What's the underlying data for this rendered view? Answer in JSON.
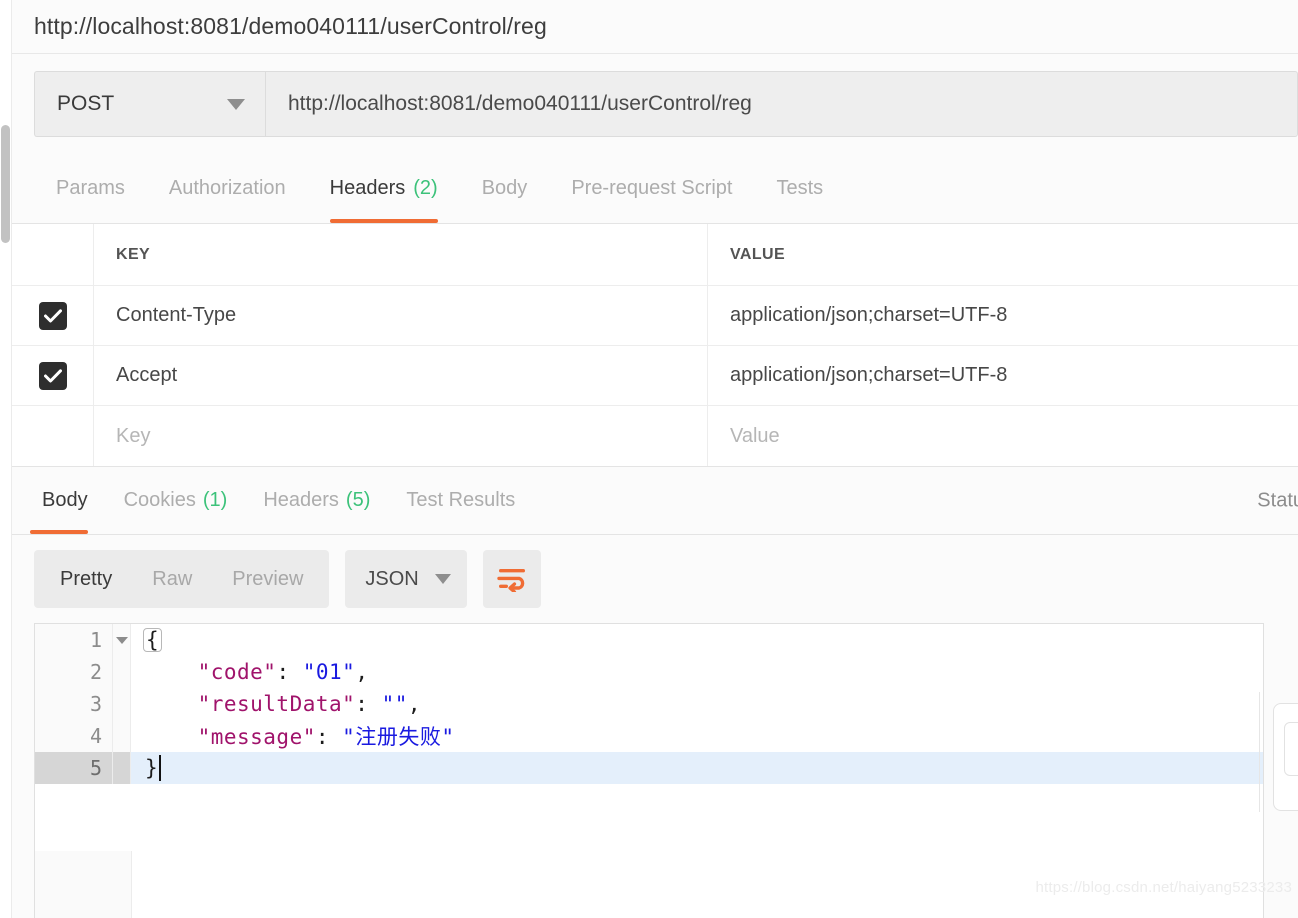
{
  "request": {
    "title": "http://localhost:8081/demo040111/userControl/reg",
    "method": "POST",
    "url": "http://localhost:8081/demo040111/userControl/reg",
    "tabs": [
      {
        "label": "Params",
        "badge": "",
        "active": false
      },
      {
        "label": "Authorization",
        "badge": "",
        "active": false
      },
      {
        "label": "Headers",
        "badge": "(2)",
        "active": true
      },
      {
        "label": "Body",
        "badge": "",
        "active": false
      },
      {
        "label": "Pre-request Script",
        "badge": "",
        "active": false
      },
      {
        "label": "Tests",
        "badge": "",
        "active": false
      }
    ]
  },
  "headers_table": {
    "columns": [
      "KEY",
      "VALUE"
    ],
    "rows": [
      {
        "checked": true,
        "key": "Content-Type",
        "value": "application/json;charset=UTF-8",
        "placeholder": false
      },
      {
        "checked": true,
        "key": "Accept",
        "value": "application/json;charset=UTF-8",
        "placeholder": false
      },
      {
        "checked": false,
        "key": "Key",
        "value": "Value",
        "placeholder": true
      }
    ]
  },
  "response": {
    "tabs": [
      {
        "label": "Body",
        "badge": "",
        "active": true
      },
      {
        "label": "Cookies",
        "badge": "(1)",
        "active": false
      },
      {
        "label": "Headers",
        "badge": "(5)",
        "active": false
      },
      {
        "label": "Test Results",
        "badge": "",
        "active": false
      }
    ],
    "status_label": "Statu",
    "view_modes": [
      {
        "label": "Pretty",
        "active": true
      },
      {
        "label": "Raw",
        "active": false
      },
      {
        "label": "Preview",
        "active": false
      }
    ],
    "language": "JSON",
    "wrap_icon": "word-wrap-icon",
    "body_lines": [
      {
        "number": "1",
        "foldable": true,
        "active": false,
        "tokens": [
          {
            "text": "{",
            "type": "brace-open"
          }
        ]
      },
      {
        "number": "2",
        "foldable": false,
        "active": false,
        "tokens": [
          {
            "text": "    \"code\"",
            "type": "key"
          },
          {
            "text": ": ",
            "type": "punct"
          },
          {
            "text": "\"01\"",
            "type": "str"
          },
          {
            "text": ",",
            "type": "punct"
          }
        ]
      },
      {
        "number": "3",
        "foldable": false,
        "active": false,
        "tokens": [
          {
            "text": "    \"resultData\"",
            "type": "key"
          },
          {
            "text": ": ",
            "type": "punct"
          },
          {
            "text": "\"\"",
            "type": "str"
          },
          {
            "text": ",",
            "type": "punct"
          }
        ]
      },
      {
        "number": "4",
        "foldable": false,
        "active": false,
        "tokens": [
          {
            "text": "    \"message\"",
            "type": "key"
          },
          {
            "text": ": ",
            "type": "punct"
          },
          {
            "text": "\"注册失败\"",
            "type": "str"
          }
        ]
      },
      {
        "number": "5",
        "foldable": false,
        "active": true,
        "tokens": [
          {
            "text": "}",
            "type": "punct"
          },
          {
            "text": "",
            "type": "caret"
          }
        ]
      }
    ]
  },
  "watermark": "https://blog.csdn.net/haiyang5233233",
  "colors": {
    "accent": "#f06c34",
    "badge_green": "#3cc27a",
    "json_key": "#a0136b",
    "json_string": "#1a1ae0",
    "active_line": "#e4effb",
    "checkbox": "#2e2e2e"
  }
}
